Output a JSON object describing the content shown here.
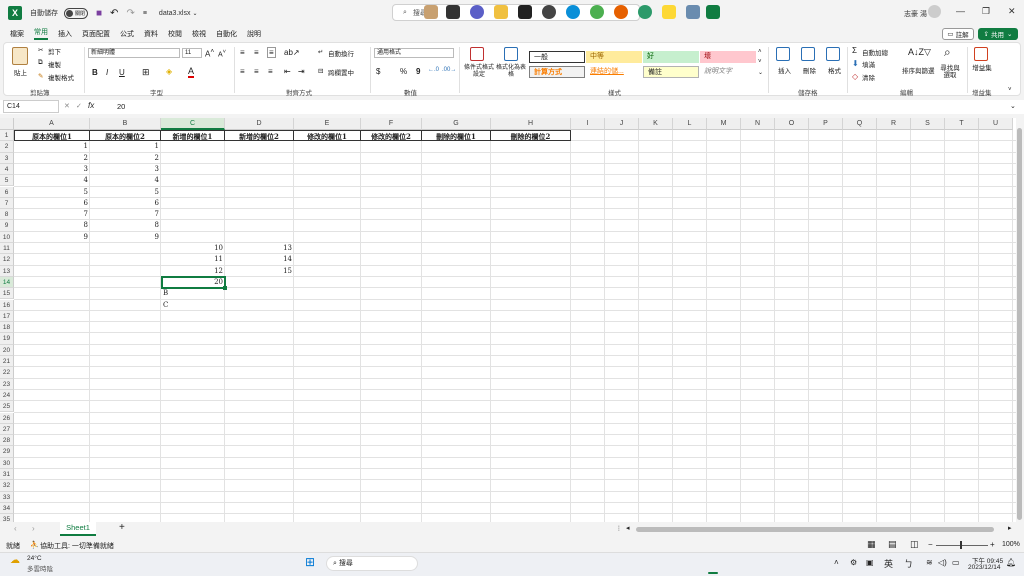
{
  "titlebar": {
    "autosave_label": "自動儲存",
    "autosave_state": "關閉",
    "filename": "data3.xlsx",
    "search_placeholder": "搜尋",
    "user_name": "志豪 湯"
  },
  "menu": {
    "items": [
      "檔案",
      "常用",
      "插入",
      "頁面配置",
      "公式",
      "資料",
      "校閱",
      "檢視",
      "自動化",
      "說明"
    ],
    "active": "常用",
    "comment_label": "註解",
    "share_label": "共用"
  },
  "ribbon": {
    "clipboard": {
      "paste": "貼上",
      "cut": "剪下",
      "copy": "複製",
      "format_painter": "複製格式",
      "label": "剪貼簿"
    },
    "font": {
      "name": "新細明體",
      "size": "11",
      "label": "字型"
    },
    "alignment": {
      "wrap": "自動換行",
      "merge": "跨欄置中",
      "label": "對齊方式"
    },
    "number": {
      "format": "通用格式",
      "label": "數值"
    },
    "styles": {
      "conditional": "條件式格式設定",
      "table": "格式化為表格",
      "normal": "一般",
      "neutral": "中等",
      "good": "好",
      "bad": "壞",
      "calculation": "計算方式",
      "linked_cell": "連結的儲...",
      "note": "備註",
      "explanatory": "說明文字",
      "label": "樣式"
    },
    "cells": {
      "insert": "插入",
      "delete": "刪除",
      "format": "格式",
      "label": "儲存格"
    },
    "editing": {
      "autosum": "自動加總",
      "fill": "填滿",
      "clear": "清除",
      "sort": "排序與篩選",
      "find": "尋找與選取",
      "label": "編輯"
    },
    "addins": {
      "name": "增益集",
      "label": "增益集"
    }
  },
  "formula_bar": {
    "name_box": "C14",
    "fx": "fx",
    "value": "20"
  },
  "grid": {
    "columns": [
      "A",
      "B",
      "C",
      "D",
      "E",
      "F",
      "G",
      "H",
      "I",
      "J",
      "K",
      "L",
      "M",
      "N",
      "O",
      "P",
      "Q",
      "R",
      "S",
      "T",
      "U"
    ],
    "selected_column": "C",
    "selected_row": "14",
    "rows": [
      "1",
      "2",
      "3",
      "4",
      "5",
      "6",
      "7",
      "8",
      "9",
      "10",
      "11",
      "12",
      "13",
      "14",
      "15",
      "16",
      "17",
      "18",
      "19",
      "20",
      "21",
      "22",
      "23",
      "24",
      "25",
      "26",
      "27",
      "28",
      "29",
      "30",
      "31",
      "32",
      "33",
      "34",
      "35"
    ],
    "headers": [
      "原本的欄位1",
      "原本的欄位2",
      "新增的欄位1",
      "新增的欄位2",
      "修改的欄位1",
      "修改的欄位2",
      "刪除的欄位1",
      "刪除的欄位2"
    ],
    "col_a": [
      "1",
      "2",
      "3",
      "4",
      "5",
      "6",
      "7",
      "8",
      "9"
    ],
    "col_b": [
      "1",
      "2",
      "3",
      "4",
      "5",
      "6",
      "7",
      "8",
      "9"
    ],
    "col_c": [
      "10",
      "11",
      "12",
      "20"
    ],
    "col_d": [
      "13",
      "14",
      "15"
    ],
    "col_c_text": [
      "B",
      "C"
    ]
  },
  "sheets": {
    "tabs": [
      "Sheet1"
    ],
    "add": "+"
  },
  "status": {
    "ready": "就緒",
    "accessibility": "協助工具: 一切準備就緒",
    "zoom": "100%"
  },
  "taskbar": {
    "weather_temp": "24°C",
    "weather_desc": "多雲時陰",
    "search_placeholder": "搜尋",
    "ime": "英",
    "time": "下午 09:45",
    "date": "2023/12/14"
  }
}
